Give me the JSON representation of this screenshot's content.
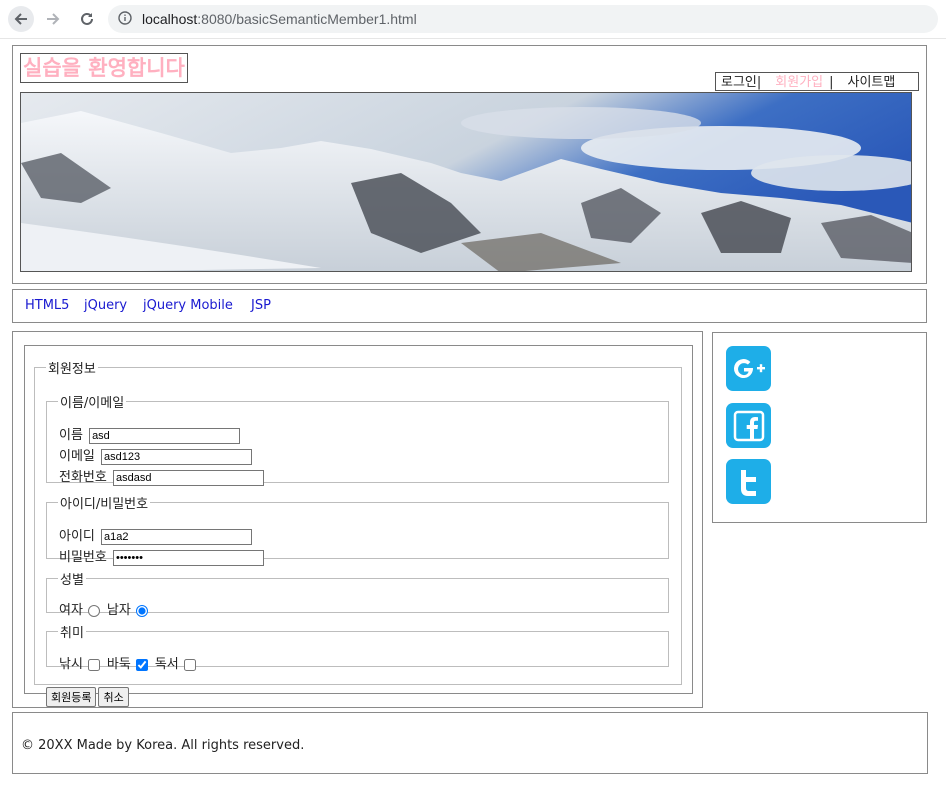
{
  "browser": {
    "url_host": "localhost",
    "url_rest": ":8080/basicSemanticMember1.html"
  },
  "header": {
    "title": "실습을 환영합니다",
    "menu": {
      "login": "로그인",
      "signup": "회원가입",
      "sitemap": "사이트맵",
      "separator": "|"
    }
  },
  "nav": {
    "items": [
      "HTML5",
      "jQuery",
      "jQuery Mobile",
      "JSP"
    ]
  },
  "form": {
    "legend": "회원정보",
    "name_section": {
      "legend": "이름/이메일",
      "name_label": "이름",
      "name_value": "asd",
      "email_label": "이메일",
      "email_value": "asd123",
      "phone_label": "전화번호",
      "phone_value": "asdasd"
    },
    "id_section": {
      "legend": "아이디/비밀번호",
      "id_label": "아이디",
      "id_value": "a1a2",
      "password_label": "비밀번호",
      "password_value": "1234567"
    },
    "gender_section": {
      "legend": "성별",
      "female_label": "여자",
      "female_checked": false,
      "male_label": "남자",
      "male_checked": true
    },
    "hobby_section": {
      "legend": "취미",
      "fishing_label": "낚시",
      "fishing_checked": false,
      "baduk_label": "바둑",
      "baduk_checked": true,
      "reading_label": "독서",
      "reading_checked": false
    },
    "submit_label": "회원등록",
    "cancel_label": "취소"
  },
  "social": [
    "google-plus-icon",
    "facebook-icon",
    "twitter-icon"
  ],
  "colors": {
    "title_pink": "#ffb0c0",
    "social_blue": "#1eaee8",
    "link_blue": "#1a1ad0"
  },
  "footer": {
    "text": "© 20XX Made by Korea. All rights reserved."
  }
}
